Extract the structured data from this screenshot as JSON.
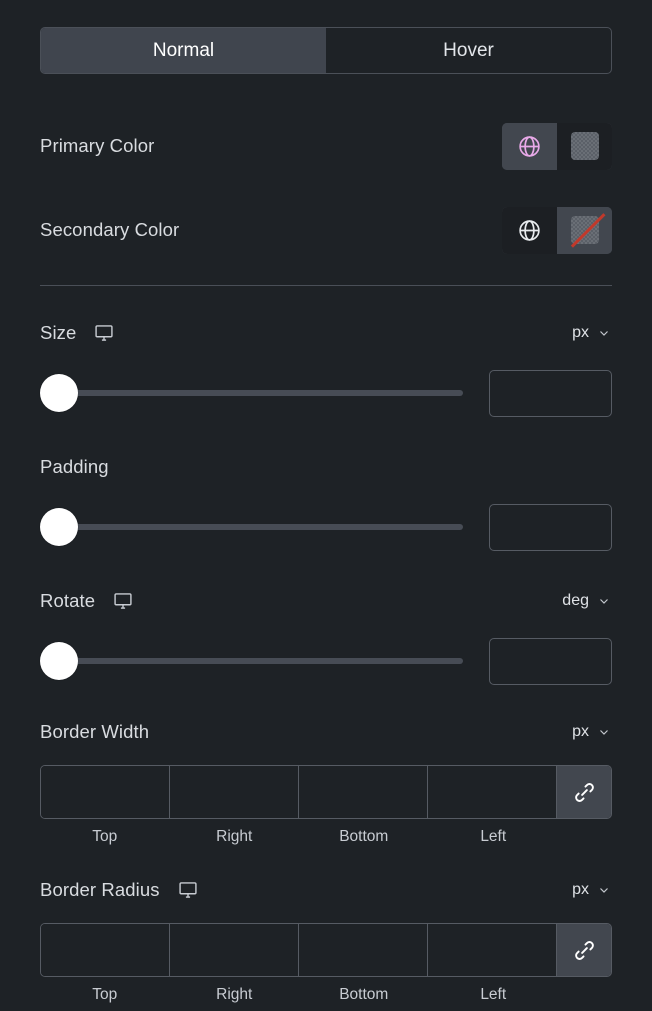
{
  "tabs": [
    {
      "label": "Normal",
      "active": true
    },
    {
      "label": "Hover",
      "active": false
    }
  ],
  "colors": {
    "primary": {
      "label": "Primary Color",
      "globe_icon": "globe-icon",
      "globe_color": "#e8a9e8",
      "swatch_state": "transparent",
      "active": true
    },
    "secondary": {
      "label": "Secondary Color",
      "globe_icon": "globe-icon",
      "globe_color": "#e8ebee",
      "swatch_state": "none",
      "active": false
    }
  },
  "size": {
    "label": "Size",
    "responsive_icon": "monitor-icon",
    "unit": "px",
    "unit_caret": "chevron-down-icon",
    "slider_value": 0,
    "input_value": "",
    "input_placeholder": ""
  },
  "padding": {
    "label": "Padding",
    "slider_value": 0,
    "input_value": "",
    "input_placeholder": ""
  },
  "rotate": {
    "label": "Rotate",
    "responsive_icon": "monitor-icon",
    "unit": "deg",
    "unit_caret": "chevron-down-icon",
    "slider_value": 0,
    "input_value": "",
    "input_placeholder": ""
  },
  "border_width": {
    "label": "Border Width",
    "unit": "px",
    "unit_caret": "chevron-down-icon",
    "link_icon": "link-icon",
    "sides": [
      {
        "label": "Top",
        "value": ""
      },
      {
        "label": "Right",
        "value": ""
      },
      {
        "label": "Bottom",
        "value": ""
      },
      {
        "label": "Left",
        "value": ""
      }
    ]
  },
  "border_radius": {
    "label": "Border Radius",
    "responsive_icon": "monitor-icon",
    "unit": "px",
    "unit_caret": "chevron-down-icon",
    "link_icon": "link-icon",
    "sides": [
      {
        "label": "Top",
        "value": ""
      },
      {
        "label": "Right",
        "value": ""
      },
      {
        "label": "Bottom",
        "value": ""
      },
      {
        "label": "Left",
        "value": ""
      }
    ]
  },
  "theme": {
    "background": "#1e2226",
    "panel_surface": "#42474f",
    "border": "#565b63",
    "text": "#d9dce0",
    "accent_pink": "#e8a9e8",
    "danger_red": "#c0392b"
  }
}
